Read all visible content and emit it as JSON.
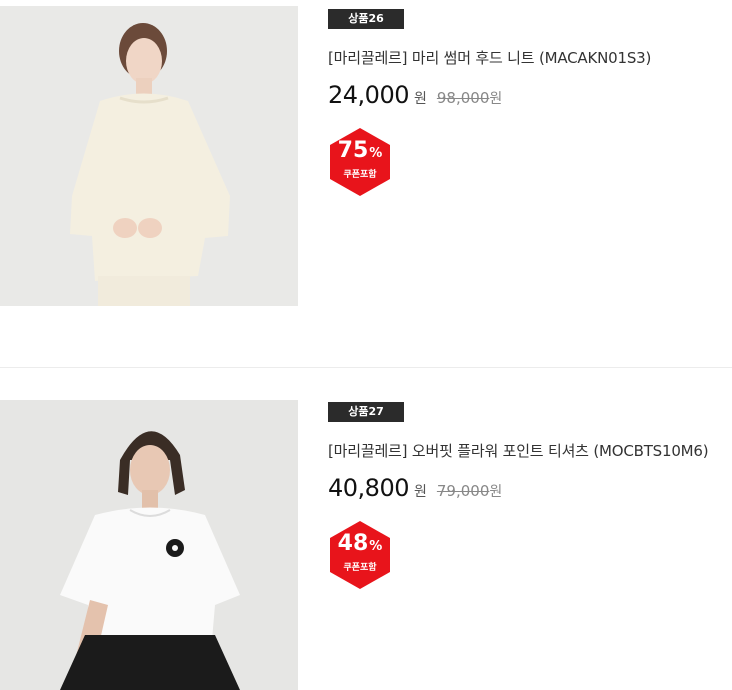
{
  "products": [
    {
      "badge": "상품26",
      "title": "[마리끌레르] 마리 썸머 후드 니트 (MACAKN01S3)",
      "price": "24,000",
      "currency": "원",
      "original_price": "98,000",
      "original_currency": "원",
      "discount_rate": "75",
      "discount_unit": "%",
      "coupon_label": "쿠폰포함"
    },
    {
      "badge": "상품27",
      "title": "[마리끌레르] 오버핏 플라워 포인트 티셔츠 (MOCBTS10M6)",
      "price": "40,800",
      "currency": "원",
      "original_price": "79,000",
      "original_currency": "원",
      "discount_rate": "48",
      "discount_unit": "%",
      "coupon_label": "쿠폰포함"
    }
  ],
  "colors": {
    "badge_bg": "#2b2b2b",
    "sale_red": "#e8141b",
    "price_text": "#111111"
  }
}
